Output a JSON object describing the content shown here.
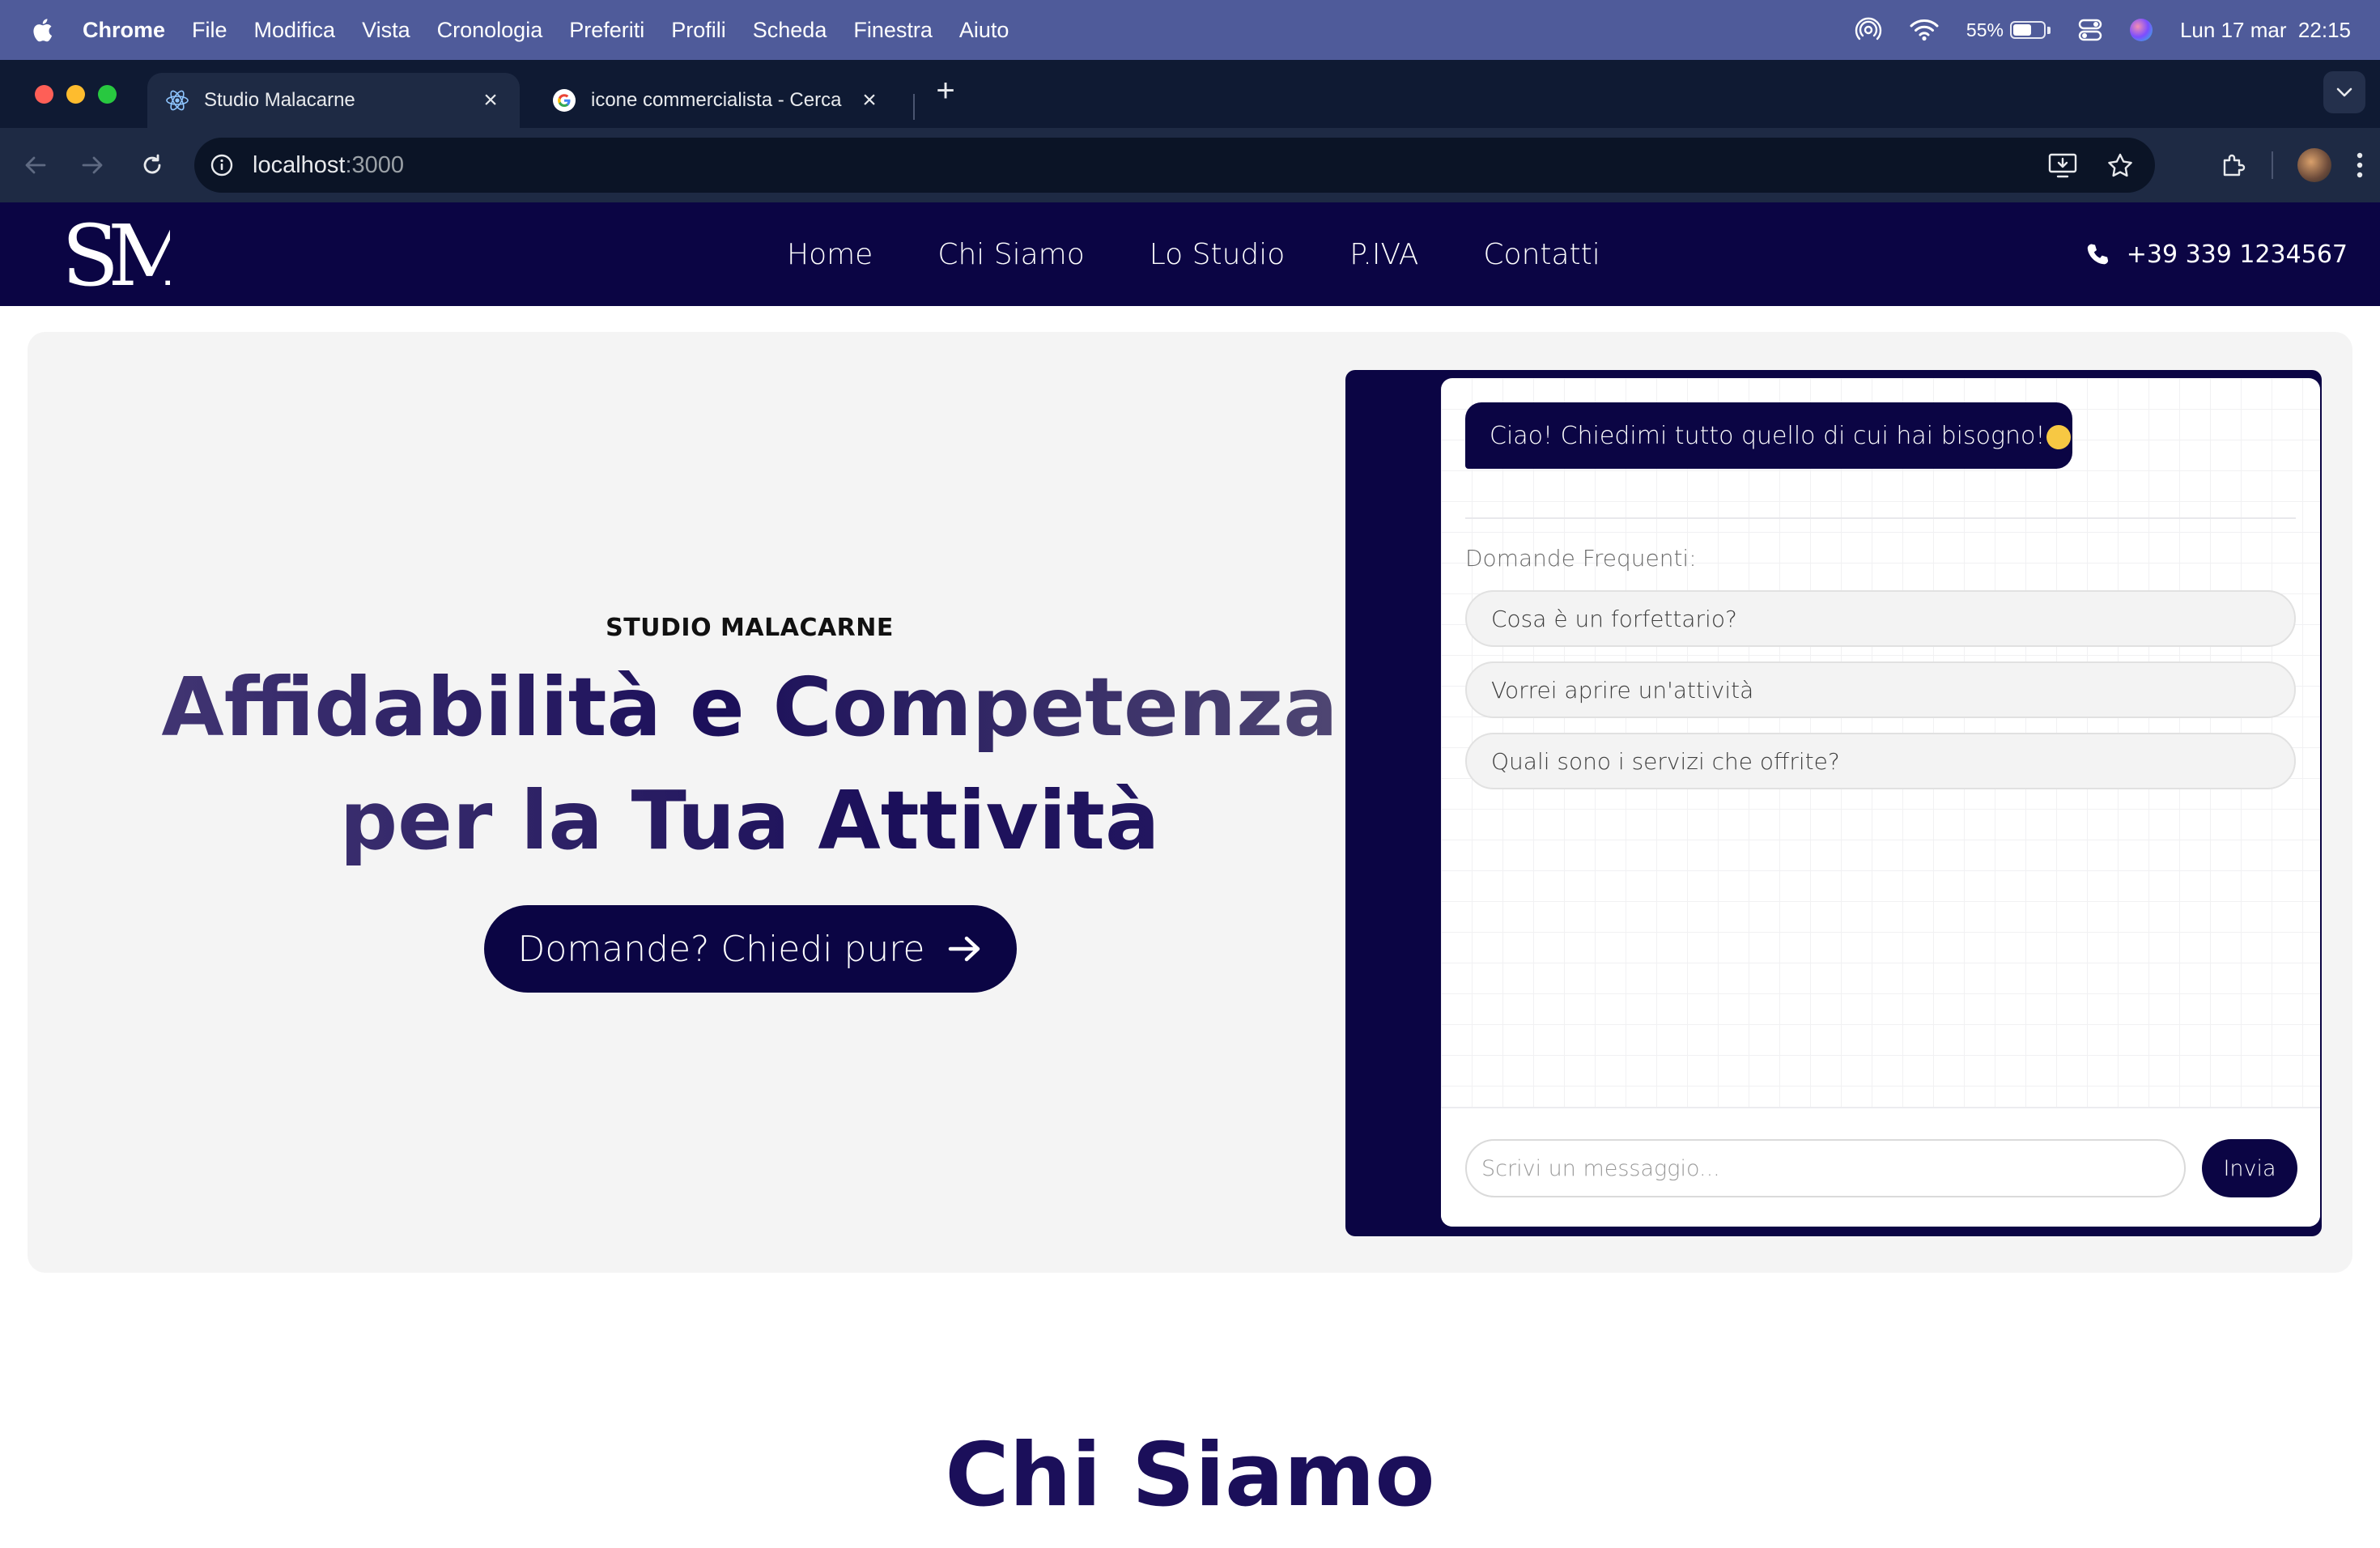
{
  "os_menu": {
    "app_name": "Chrome",
    "items": [
      "File",
      "Modifica",
      "Vista",
      "Cronologia",
      "Preferiti",
      "Profili",
      "Scheda",
      "Finestra",
      "Aiuto"
    ],
    "battery_percent": "55%",
    "datetime": "Lun 17 mar  22:15",
    "icons": [
      "apple-icon",
      "airdrop-icon",
      "wifi-icon",
      "battery-icon",
      "control-center-icon",
      "siri-icon"
    ]
  },
  "browser": {
    "tabs": [
      {
        "title": "Studio Malacarne",
        "favicon": "react-icon",
        "active": true
      },
      {
        "title": "icone commercialista - Cerca",
        "favicon": "google-icon",
        "active": false
      }
    ],
    "url_host": "localhost",
    "url_port": ":3000"
  },
  "site": {
    "logo_text": "SM",
    "nav": [
      "Home",
      "Chi Siamo",
      "Lo Studio",
      "P.IVA",
      "Contatti"
    ],
    "phone": "+39 339 1234567"
  },
  "hero": {
    "kicker": "STUDIO MALACARNE",
    "headline_line1": "Affidabilità e Competenza",
    "headline_line2": "per la Tua Attività",
    "cta_label": "Domande? Chiedi pure"
  },
  "chat": {
    "bot_message": "Ciao! Chiedimi tutto quello di cui hai bisogno!",
    "faq_label": "Domande Frequenti:",
    "faq": [
      "Cosa è un forfettario?",
      "Vorrei aprire un'attività",
      "Quali sono i servizi che offrite?"
    ],
    "input_placeholder": "Scrivi un messaggio...",
    "send_label": "Invia"
  },
  "sections": {
    "chi_siamo_title": "Chi Siamo"
  },
  "colors": {
    "navy": "#0b0544",
    "mac_menubar": "#4f5b9a",
    "chrome_dark": "#0f1a33",
    "hero_bg": "#f4f4f4"
  }
}
